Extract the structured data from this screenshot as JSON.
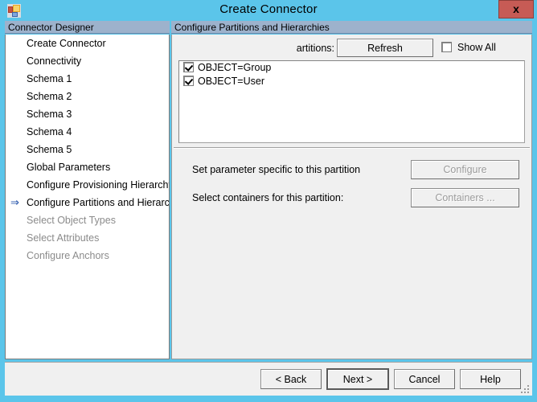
{
  "window": {
    "title": "Create Connector",
    "icon": "app-window-icon",
    "close_label": "x",
    "accent_color": "#5bc5ea",
    "close_button_color": "#c75b55",
    "panel_header_color": "#9db2cc"
  },
  "sidebar": {
    "header": "Connector Designer",
    "items": [
      {
        "label": "Create Connector",
        "state": "enabled",
        "current": false
      },
      {
        "label": "Connectivity",
        "state": "enabled",
        "current": false
      },
      {
        "label": "Schema 1",
        "state": "enabled",
        "current": false
      },
      {
        "label": "Schema 2",
        "state": "enabled",
        "current": false
      },
      {
        "label": "Schema 3",
        "state": "enabled",
        "current": false
      },
      {
        "label": "Schema 4",
        "state": "enabled",
        "current": false
      },
      {
        "label": "Schema 5",
        "state": "enabled",
        "current": false
      },
      {
        "label": "Global Parameters",
        "state": "enabled",
        "current": false
      },
      {
        "label": "Configure Provisioning Hierarchy",
        "state": "enabled",
        "current": false
      },
      {
        "label": "Configure Partitions and Hierarchies",
        "state": "enabled",
        "current": true
      },
      {
        "label": "Select Object Types",
        "state": "disabled",
        "current": false
      },
      {
        "label": "Select Attributes",
        "state": "disabled",
        "current": false
      },
      {
        "label": "Configure Anchors",
        "state": "disabled",
        "current": false
      }
    ],
    "current_marker": "⇒"
  },
  "main": {
    "header": "Configure Partitions and Hierarchies",
    "partitions_label": "artitions:",
    "refresh_label": "Refresh",
    "show_all_label": "Show All",
    "show_all_checked": false,
    "partitions": [
      {
        "label": "OBJECT=Group",
        "checked": true
      },
      {
        "label": "OBJECT=User",
        "checked": true
      }
    ],
    "set_parameter_label": "Set parameter specific to this partition",
    "configure_label": "Configure",
    "configure_enabled": false,
    "select_containers_label": "Select containers for this partition:",
    "containers_label": "Containers ...",
    "containers_enabled": false
  },
  "footer": {
    "back_label": "< Back",
    "next_label": "Next  >",
    "cancel_label": "Cancel",
    "help_label": "Help"
  }
}
